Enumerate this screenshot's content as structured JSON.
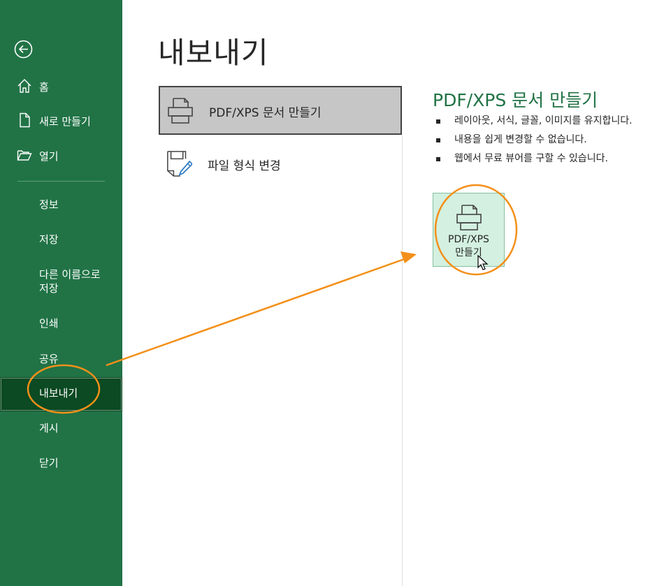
{
  "sidebar": {
    "home": "홈",
    "new": "새로 만들기",
    "open": "열기",
    "items": [
      {
        "label": "정보"
      },
      {
        "label": "저장"
      },
      {
        "label": "다른 이름으로 저장"
      },
      {
        "label": "인쇄"
      },
      {
        "label": "공유"
      },
      {
        "label": "내보내기"
      },
      {
        "label": "게시"
      },
      {
        "label": "닫기"
      }
    ],
    "selected": "내보내기"
  },
  "main": {
    "title": "내보내기",
    "options": [
      {
        "label": "PDF/XPS 문서 만들기",
        "icon": "printer-icon",
        "selected": true
      },
      {
        "label": "파일 형식 변경",
        "icon": "file-format-edit-icon",
        "selected": false
      }
    ]
  },
  "detail": {
    "title": "PDF/XPS 문서 만들기",
    "bullets": [
      "레이아웃, 서식, 글꼴, 이미지를 유지합니다.",
      "내용을 쉽게 변경할 수 없습니다.",
      "웹에서 무료 뷰어를 구할 수 있습니다."
    ],
    "button": {
      "line1": "PDF/XPS",
      "line2": "만들기",
      "icon": "printer-icon"
    }
  },
  "colors": {
    "sidebar": "#217346",
    "sidebar_selected": "#0b4a22",
    "accent_text": "#217346",
    "button_bg": "#d3f0e0",
    "annotation": "#f39019"
  }
}
